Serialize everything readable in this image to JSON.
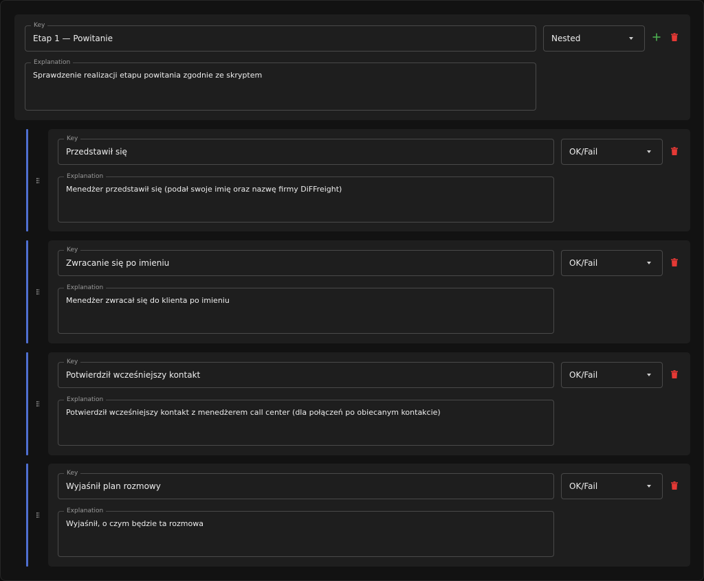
{
  "labels": {
    "key": "Key",
    "explanation": "Explanation"
  },
  "icons": {
    "add": "plus-icon",
    "delete": "trash-icon",
    "drag": "drag-handle-icon",
    "caret": "chevron-down-icon"
  },
  "colors": {
    "add": "#4caf50",
    "delete": "#e53935",
    "rail": "#4f6fd1"
  },
  "parent": {
    "key": "Etap 1 — Powitanie",
    "explanation": "Sprawdzenie realizacji etapu powitania zgodnie ze skryptem",
    "type": "Nested"
  },
  "children": [
    {
      "key": "Przedstawił się",
      "explanation": "Menedżer przedstawił się (podał swoje imię oraz nazwę firmy DiFFreight)",
      "type": "OK/Fail"
    },
    {
      "key": "Zwracanie się po imieniu",
      "explanation": "Menedżer zwracał się do klienta po imieniu",
      "type": "OK/Fail"
    },
    {
      "key": "Potwierdził wcześniejszy kontakt",
      "explanation": "Potwierdził wcześniejszy kontakt z menedżerem call center (dla połączeń po obiecanym kontakcie)",
      "type": "OK/Fail"
    },
    {
      "key": "Wyjaśnił plan rozmowy",
      "explanation": "Wyjaśnił, o czym będzie ta rozmowa",
      "type": "OK/Fail"
    }
  ]
}
